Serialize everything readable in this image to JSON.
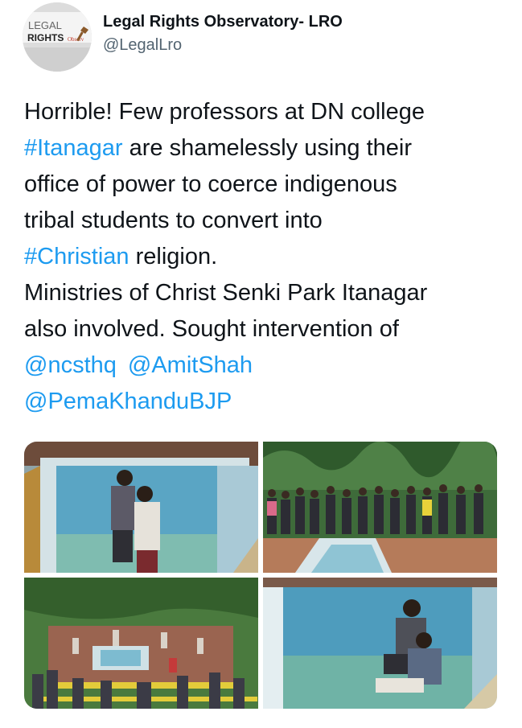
{
  "author": {
    "name": "Legal Rights Observatory- LRO",
    "handle": "@LegalLro",
    "avatar_text": [
      "LEGAL",
      "RIGHTS",
      "Observ"
    ]
  },
  "tweet": {
    "line1": "Horrible! Few professors at DN college",
    "hashtag_itanagar": "#Itanagar",
    "line2_rest": " are shamelessly using their",
    "line3": "office of power to coerce indigenous",
    "line4": "tribal students to convert into",
    "hashtag_christian": "#Christian",
    "line5_rest": " religion.",
    "line6": "Ministries of Christ Senki Park Itanagar",
    "line7": "also involved. Sought intervention of",
    "mention_ncst": "@ncsthq",
    "mention_amit": "@AmitShah",
    "mention_pema": "@PemaKhanduBJP"
  },
  "media": {
    "photos": [
      {
        "name": "pool-baptism-photo-1"
      },
      {
        "name": "group-standing-photo"
      },
      {
        "name": "crowd-around-pool-photo"
      },
      {
        "name": "pool-baptism-photo-2"
      }
    ]
  },
  "colors": {
    "link": "#1d9bf0",
    "text": "#0f1419",
    "secondary": "#536471"
  }
}
